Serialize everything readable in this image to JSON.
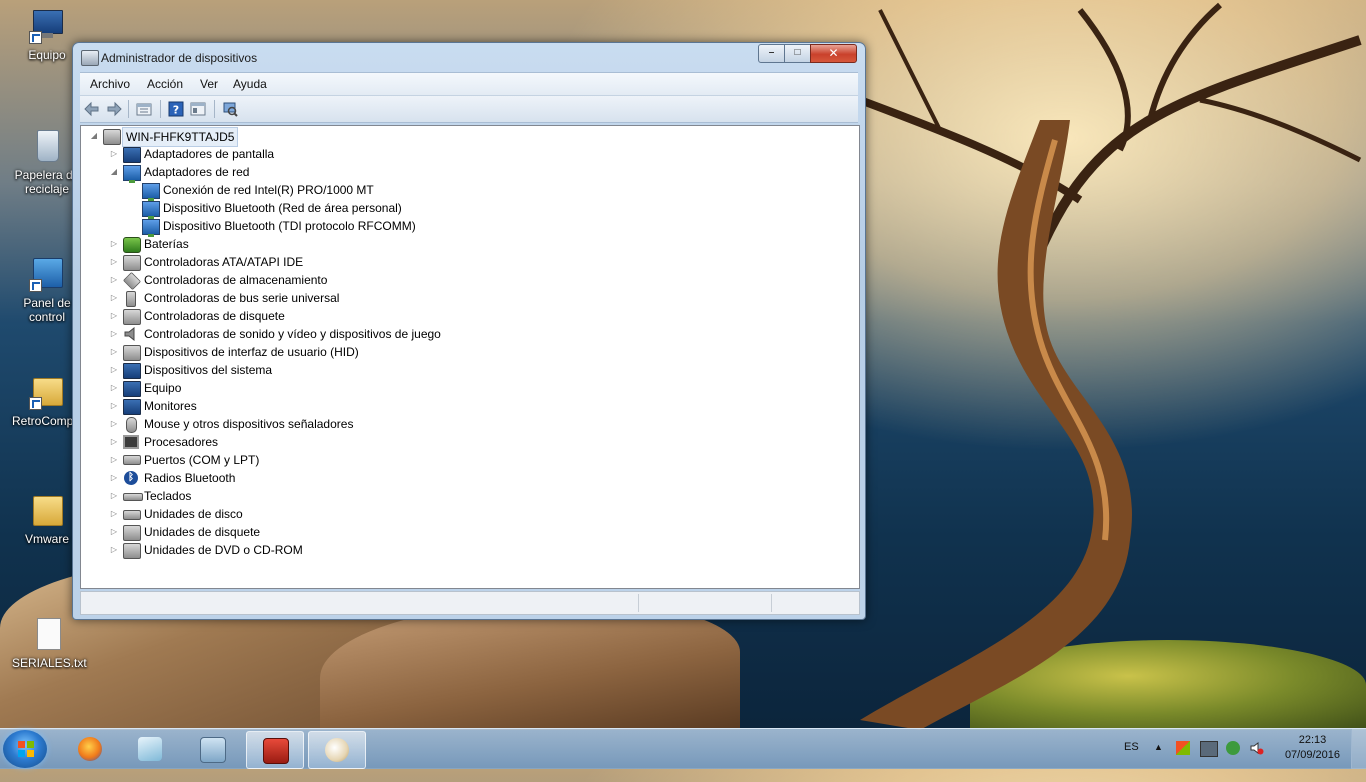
{
  "desktop": {
    "icons": [
      {
        "label": "Equipo",
        "icon": "computer-icon"
      },
      {
        "label": "Papelera de reciclaje",
        "icon": "recycle-bin-icon"
      },
      {
        "label": "Panel de control",
        "icon": "control-panel-icon"
      },
      {
        "label": "RetroComputacion",
        "icon": "user-folder-icon"
      },
      {
        "label": "Vmware",
        "icon": "folder-icon"
      },
      {
        "label": "SERIALES.txt",
        "icon": "text-file-icon"
      }
    ]
  },
  "window": {
    "title": "Administrador de dispositivos",
    "menu": [
      "Archivo",
      "Acción",
      "Ver",
      "Ayuda"
    ],
    "tree": {
      "root": "WIN-FHFK9TTAJD5",
      "nodes": [
        {
          "label": "Adaptadores de pantalla",
          "icon": "display-adapter-icon",
          "expanded": false
        },
        {
          "label": "Adaptadores de red",
          "icon": "network-adapter-icon",
          "expanded": true,
          "children": [
            "Conexión de red Intel(R) PRO/1000 MT",
            "Dispositivo Bluetooth (Red de área personal)",
            "Dispositivo Bluetooth (TDI protocolo RFCOMM)"
          ]
        },
        {
          "label": "Baterías",
          "icon": "battery-icon",
          "expanded": false
        },
        {
          "label": "Controladoras ATA/ATAPI IDE",
          "icon": "ide-controller-icon",
          "expanded": false
        },
        {
          "label": "Controladoras de almacenamiento",
          "icon": "storage-controller-icon",
          "expanded": false
        },
        {
          "label": "Controladoras de bus serie universal",
          "icon": "usb-icon",
          "expanded": false
        },
        {
          "label": "Controladoras de disquete",
          "icon": "floppy-controller-icon",
          "expanded": false
        },
        {
          "label": "Controladoras de sonido y vídeo y dispositivos de juego",
          "icon": "speaker-icon",
          "expanded": false
        },
        {
          "label": "Dispositivos de interfaz de usuario (HID)",
          "icon": "hid-icon",
          "expanded": false
        },
        {
          "label": "Dispositivos del sistema",
          "icon": "system-device-icon",
          "expanded": false
        },
        {
          "label": "Equipo",
          "icon": "computer-icon",
          "expanded": false
        },
        {
          "label": "Monitores",
          "icon": "monitor-icon",
          "expanded": false
        },
        {
          "label": "Mouse y otros dispositivos señaladores",
          "icon": "mouse-icon",
          "expanded": false
        },
        {
          "label": "Procesadores",
          "icon": "processor-icon",
          "expanded": false
        },
        {
          "label": "Puertos (COM y LPT)",
          "icon": "port-icon",
          "expanded": false
        },
        {
          "label": "Radios Bluetooth",
          "icon": "bluetooth-icon",
          "expanded": false
        },
        {
          "label": "Teclados",
          "icon": "keyboard-icon",
          "expanded": false
        },
        {
          "label": "Unidades de disco",
          "icon": "disk-drive-icon",
          "expanded": false
        },
        {
          "label": "Unidades de disquete",
          "icon": "floppy-drive-icon",
          "expanded": false
        },
        {
          "label": "Unidades de DVD o CD-ROM",
          "icon": "dvd-drive-icon",
          "expanded": false
        }
      ]
    }
  },
  "taskbar": {
    "apps": [
      "firefox-icon",
      "notepad-icon",
      "calculator-icon",
      "toolbox-icon",
      "paint-icon"
    ],
    "language": "ES",
    "time": "22:13",
    "date": "07/09/2016"
  },
  "colors": {
    "selection": "#e5eef8",
    "close_button": "#c9412b"
  }
}
